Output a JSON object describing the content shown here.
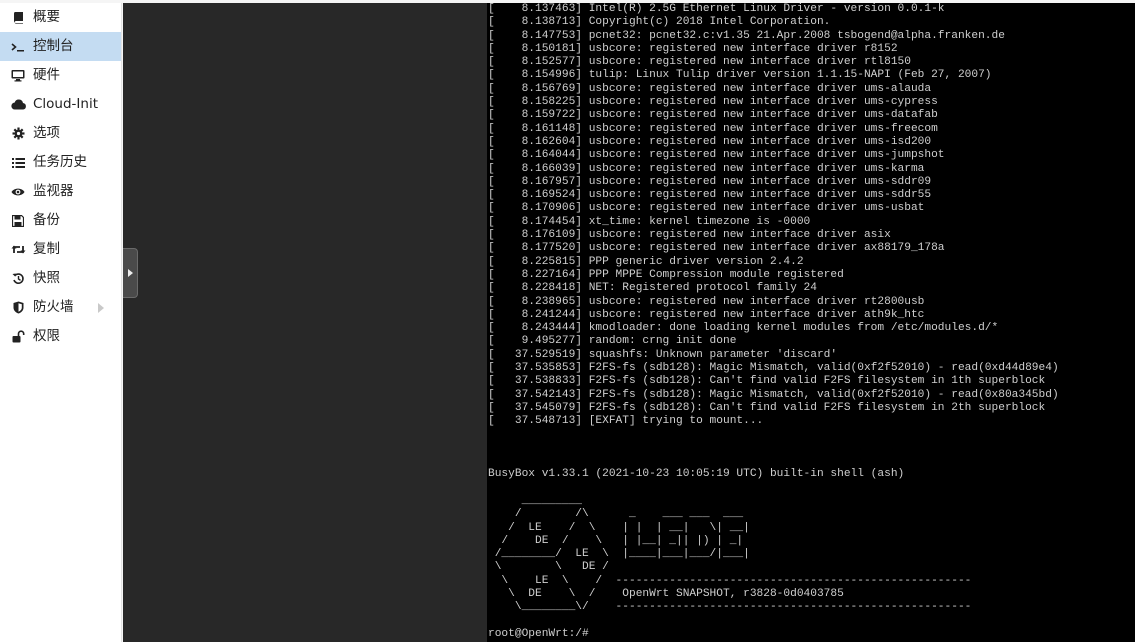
{
  "sidebar": {
    "items": [
      {
        "label": "概要",
        "icon": "book-icon"
      },
      {
        "label": "控制台",
        "icon": "terminal-icon",
        "active": true
      },
      {
        "label": "硬件",
        "icon": "desktop-icon"
      },
      {
        "label": "Cloud-Init",
        "icon": "cloud-icon"
      },
      {
        "label": "选项",
        "icon": "gear-icon"
      },
      {
        "label": "任务历史",
        "icon": "list-icon"
      },
      {
        "label": "监视器",
        "icon": "eye-icon"
      },
      {
        "label": "备份",
        "icon": "floppy-icon"
      },
      {
        "label": "复制",
        "icon": "retweet-icon"
      },
      {
        "label": "快照",
        "icon": "history-icon"
      },
      {
        "label": "防火墙",
        "icon": "shield-icon",
        "has_submenu": true
      },
      {
        "label": "权限",
        "icon": "unlock-icon"
      }
    ]
  },
  "colors": {
    "sidebar_bg": "#ffffff",
    "active_bg": "#c4dcf2",
    "dark_area_bg": "#282828",
    "terminal_bg": "#000000",
    "terminal_fg": "#cfcfcf"
  },
  "terminal": {
    "lines": [
      "[    8.137463] Intel(R) 2.5G Ethernet Linux Driver - version 0.0.1-k",
      "[    8.138713] Copyright(c) 2018 Intel Corporation.",
      "[    8.147753] pcnet32: pcnet32.c:v1.35 21.Apr.2008 tsbogend@alpha.franken.de",
      "[    8.150181] usbcore: registered new interface driver r8152",
      "[    8.152577] usbcore: registered new interface driver rtl8150",
      "[    8.154996] tulip: Linux Tulip driver version 1.1.15-NAPI (Feb 27, 2007)",
      "[    8.156769] usbcore: registered new interface driver ums-alauda",
      "[    8.158225] usbcore: registered new interface driver ums-cypress",
      "[    8.159722] usbcore: registered new interface driver ums-datafab",
      "[    8.161148] usbcore: registered new interface driver ums-freecom",
      "[    8.162604] usbcore: registered new interface driver ums-isd200",
      "[    8.164044] usbcore: registered new interface driver ums-jumpshot",
      "[    8.166039] usbcore: registered new interface driver ums-karma",
      "[    8.167957] usbcore: registered new interface driver ums-sddr09",
      "[    8.169524] usbcore: registered new interface driver ums-sddr55",
      "[    8.170906] usbcore: registered new interface driver ums-usbat",
      "[    8.174454] xt_time: kernel timezone is -0000",
      "[    8.176109] usbcore: registered new interface driver asix",
      "[    8.177520] usbcore: registered new interface driver ax88179_178a",
      "[    8.225815] PPP generic driver version 2.4.2",
      "[    8.227164] PPP MPPE Compression module registered",
      "[    8.228418] NET: Registered protocol family 24",
      "[    8.238965] usbcore: registered new interface driver rt2800usb",
      "[    8.241244] usbcore: registered new interface driver ath9k_htc",
      "[    8.243444] kmodloader: done loading kernel modules from /etc/modules.d/*",
      "[    9.495277] random: crng init done",
      "[   37.529519] squashfs: Unknown parameter 'discard'",
      "[   37.535853] F2FS-fs (sdb128): Magic Mismatch, valid(0xf2f52010) - read(0xd44d89e4)",
      "[   37.538833] F2FS-fs (sdb128): Can't find valid F2FS filesystem in 1th superblock",
      "[   37.542143] F2FS-fs (sdb128): Magic Mismatch, valid(0xf2f52010) - read(0x80a345bd)",
      "[   37.545079] F2FS-fs (sdb128): Can't find valid F2FS filesystem in 2th superblock",
      "[   37.548713] [EXFAT] trying to mount...",
      "",
      "",
      "",
      "BusyBox v1.33.1 (2021-10-23 10:05:19 UTC) built-in shell (ash)",
      "",
      "     _________",
      "    /        /\\      _    ___ ___  ___",
      "   /  LE    /  \\    | |  | __|   \\| __|",
      "  /    DE  /    \\   | |__| _|| |) | _|",
      " /________/  LE  \\  |____|___|___/|___|",
      " \\        \\   DE /",
      "  \\    LE  \\    /  -----------------------------------------------------",
      "   \\  DE    \\  /    OpenWrt SNAPSHOT, r3828-0d0403785",
      "    \\________\\/    -----------------------------------------------------",
      "",
      "root@OpenWrt:/#"
    ]
  }
}
